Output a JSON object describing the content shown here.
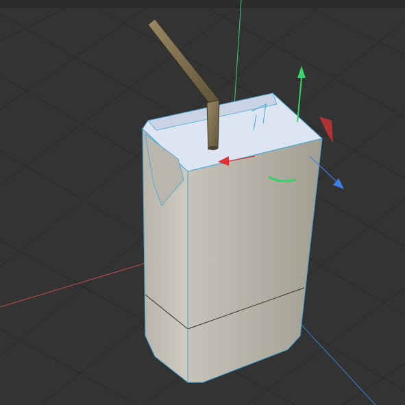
{
  "viewport": {
    "background_color": "#333333",
    "grid_color": "#2a2a2a",
    "axis_x_color": "#c0504d",
    "axis_y_color": "#3ad17a",
    "axis_z_color": "#3a7fd4"
  },
  "object": {
    "kind": "juice box with bent straw",
    "body_color": "#aaa59a",
    "top_color": "#dde5f2",
    "edge_highlight_color": "#3fa9d8",
    "straw_color": "#7a6a4a"
  },
  "gizmo": {
    "move_x_arrow_color": "#e03030",
    "move_y_arrow_color": "#36d36a",
    "move_z_arrow_color": "#3a7fe8",
    "rotate_handle_color": "#c03a3a"
  }
}
